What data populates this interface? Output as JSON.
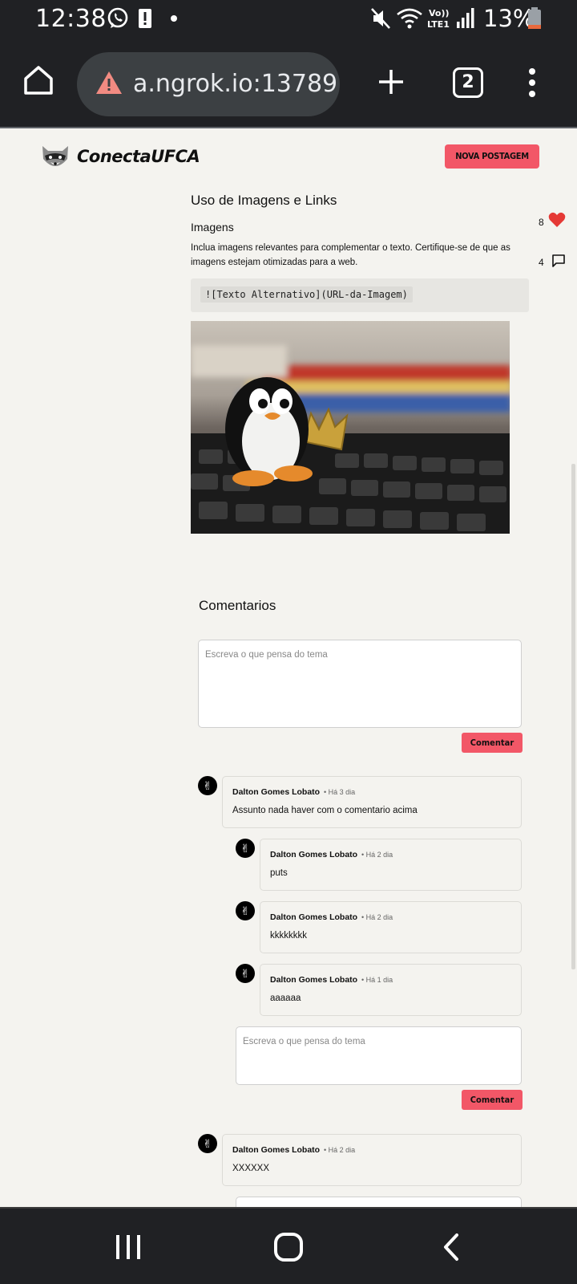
{
  "status_bar": {
    "time": "12:38",
    "battery_percent": "13%",
    "icons": [
      "whatsapp-icon",
      "alert-icon",
      "dot-icon",
      "mute-icon",
      "wifi-icon",
      "volte-icon",
      "signal-icon",
      "battery-icon"
    ]
  },
  "browser": {
    "url": "a.ngrok.io:13789",
    "tab_count": "2"
  },
  "site": {
    "brand": "ConectaUFCA",
    "new_post_label": "NOVA POSTAGEM"
  },
  "post": {
    "title": "Uso de Imagens e Links",
    "subtitle": "Imagens",
    "paragraph": "Inclua imagens relevantes para complementar o texto. Certifique-se de que as imagens estejam otimizadas para a web.",
    "code": "![Texto Alternativo](URL-da-Imagem)",
    "likes": "8",
    "comments_count": "4"
  },
  "comments_section": {
    "title": "Comentarios",
    "placeholder": "Escreva o que pensa do tema",
    "submit_label": "Comentar",
    "comments": [
      {
        "author": "Dalton Gomes Lobato",
        "time": "• Há 3 dia",
        "text": "Assunto nada haver com o comentario acima",
        "replies": [
          {
            "author": "Dalton Gomes Lobato",
            "time": "• Há 2 dia",
            "text": "puts"
          },
          {
            "author": "Dalton Gomes Lobato",
            "time": "• Há 2 dia",
            "text": "kkkkkkkk"
          },
          {
            "author": "Dalton Gomes Lobato",
            "time": "• Há 1 dia",
            "text": "aaaaaa"
          }
        ]
      },
      {
        "author": "Dalton Gomes Lobato",
        "time": "• Há 2 dia",
        "text": "XXXXXX",
        "replies": []
      }
    ]
  }
}
